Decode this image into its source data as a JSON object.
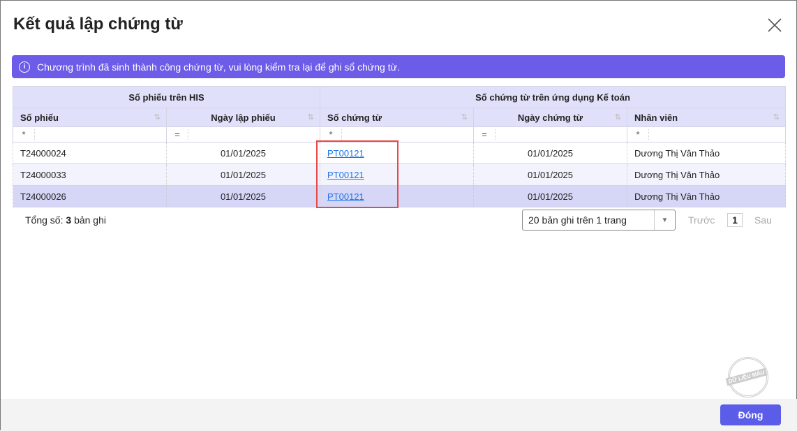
{
  "title": "Kết quả lập chứng từ",
  "banner": "Chương trình đã sinh thành công chứng từ, vui lòng kiểm tra lại để ghi sổ chứng từ.",
  "groups": [
    "Số phiếu trên HIS",
    "Số chứng từ trên ứng dụng Kế toán"
  ],
  "columns": [
    "Số phiếu",
    "Ngày lập phiếu",
    "Số chứng từ",
    "Ngày chứng từ",
    "Nhân viên"
  ],
  "filters": [
    "*",
    "=",
    "*",
    "=",
    "*"
  ],
  "rows": [
    {
      "so_phieu": "T24000024",
      "ngay_lap": "01/01/2025",
      "so_ct": "PT00121",
      "ngay_ct": "01/01/2025",
      "nhan_vien": "Dương Thị Vân Thảo"
    },
    {
      "so_phieu": "T24000033",
      "ngay_lap": "01/01/2025",
      "so_ct": "PT00121",
      "ngay_ct": "01/01/2025",
      "nhan_vien": "Dương Thị Vân Thảo"
    },
    {
      "so_phieu": "T24000026",
      "ngay_lap": "01/01/2025",
      "so_ct": "PT00121",
      "ngay_ct": "01/01/2025",
      "nhan_vien": "Dương Thị Vân Thảo"
    }
  ],
  "footer": {
    "total_label": "Tổng số:",
    "total": "3",
    "total_unit": "bản ghi",
    "page_size": "20 bản ghi trên 1 trang",
    "prev": "Trước",
    "page": "1",
    "next": "Sau"
  },
  "stamp": "DỮ LIỆU MẪU",
  "close_button": "Đóng"
}
